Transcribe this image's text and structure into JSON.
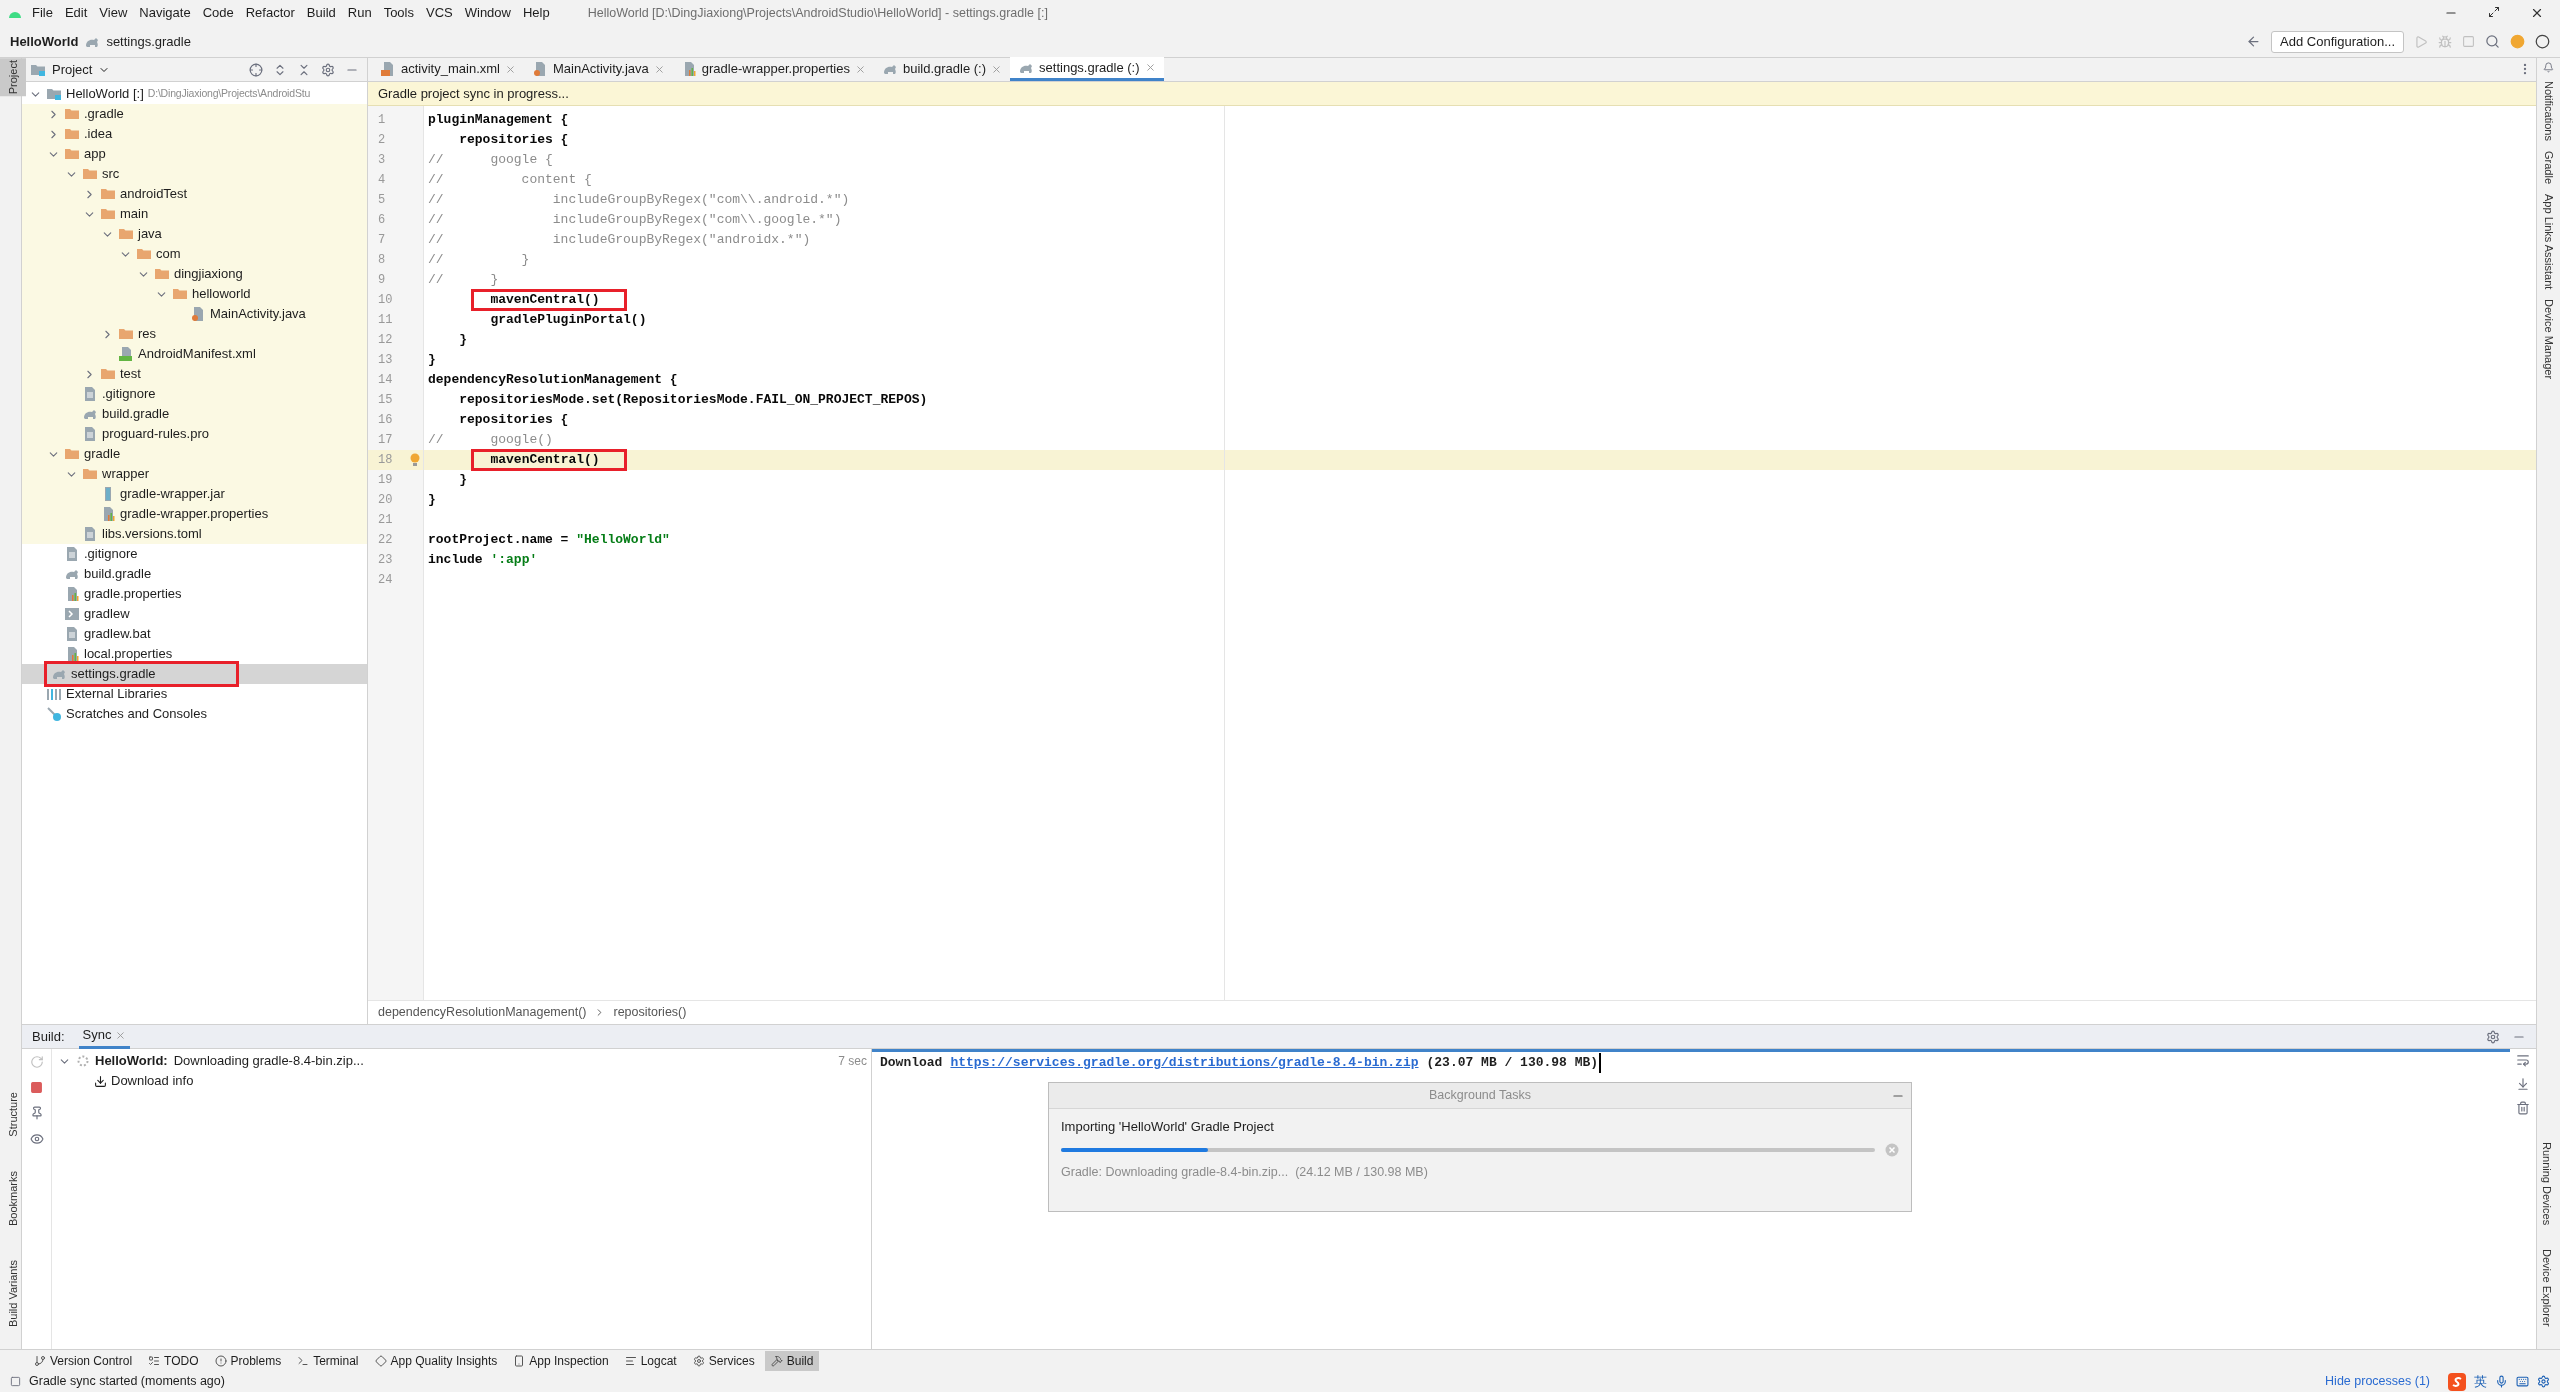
{
  "window": {
    "title": "HelloWorld [D:\\DingJiaxiong\\Projects\\AndroidStudio\\HelloWorld] - settings.gradle [:]",
    "menu": [
      "File",
      "Edit",
      "View",
      "Navigate",
      "Code",
      "Refactor",
      "Build",
      "Run",
      "Tools",
      "VCS",
      "Window",
      "Help"
    ]
  },
  "navbar": {
    "project": "HelloWorld",
    "file": "settings.gradle",
    "run_config": "Add Configuration..."
  },
  "left_stripe": {
    "top": [
      {
        "label": "Project",
        "selected": true
      }
    ],
    "bottom": [
      {
        "label": "Structure",
        "selected": false
      },
      {
        "label": "Bookmarks",
        "selected": false
      },
      {
        "label": "Build Variants",
        "selected": false
      }
    ]
  },
  "right_stripe": {
    "top": [
      "Notifications",
      "Gradle",
      "App Links Assistant",
      "Device Manager"
    ],
    "bottom": [
      "Running Devices",
      "Device Explorer"
    ]
  },
  "project_panel": {
    "title": "Project",
    "tree": [
      {
        "label": "HelloWorld [:]",
        "path": "D:\\DingJiaxiong\\Projects\\AndroidStu",
        "kind": "module",
        "expanded": true,
        "selected": false,
        "annotated": false,
        "children": [
          {
            "label": ".gradle",
            "kind": "folder",
            "expanded": false,
            "selected": false,
            "annotated": false,
            "tinted": true
          },
          {
            "label": ".idea",
            "kind": "folder",
            "expanded": false,
            "selected": false,
            "annotated": false,
            "tinted": true
          },
          {
            "label": "app",
            "kind": "folder",
            "expanded": true,
            "selected": false,
            "annotated": false,
            "tinted": true,
            "children": [
              {
                "label": "src",
                "kind": "folder",
                "expanded": true,
                "selected": false,
                "annotated": false,
                "children": [
                  {
                    "label": "androidTest",
                    "kind": "folder",
                    "expanded": false,
                    "selected": false,
                    "annotated": false
                  },
                  {
                    "label": "main",
                    "kind": "folder",
                    "expanded": true,
                    "selected": false,
                    "annotated": false,
                    "children": [
                      {
                        "label": "java",
                        "kind": "folder",
                        "expanded": true,
                        "selected": false,
                        "annotated": false,
                        "children": [
                          {
                            "label": "com",
                            "kind": "folder",
                            "expanded": true,
                            "selected": false,
                            "annotated": false,
                            "children": [
                              {
                                "label": "dingjiaxiong",
                                "kind": "folder",
                                "expanded": true,
                                "selected": false,
                                "annotated": false,
                                "children": [
                                  {
                                    "label": "helloworld",
                                    "kind": "folder",
                                    "expanded": true,
                                    "selected": false,
                                    "annotated": false,
                                    "children": [
                                      {
                                        "label": "MainActivity.java",
                                        "kind": "java",
                                        "selected": false,
                                        "annotated": false
                                      }
                                    ]
                                  }
                                ]
                              }
                            ]
                          }
                        ]
                      },
                      {
                        "label": "res",
                        "kind": "folder",
                        "expanded": false,
                        "selected": false,
                        "annotated": false
                      },
                      {
                        "label": "AndroidManifest.xml",
                        "kind": "manifest",
                        "selected": false,
                        "annotated": false
                      }
                    ]
                  },
                  {
                    "label": "test",
                    "kind": "folder",
                    "expanded": false,
                    "selected": false,
                    "annotated": false
                  }
                ]
              },
              {
                "label": ".gitignore",
                "kind": "ignore",
                "selected": false,
                "annotated": false
              },
              {
                "label": "build.gradle",
                "kind": "gradle",
                "selected": false,
                "annotated": false
              },
              {
                "label": "proguard-rules.pro",
                "kind": "text",
                "selected": false,
                "annotated": false
              }
            ]
          },
          {
            "label": "gradle",
            "kind": "folder",
            "expanded": true,
            "selected": false,
            "annotated": false,
            "tinted": true,
            "children": [
              {
                "label": "wrapper",
                "kind": "folder",
                "expanded": true,
                "selected": false,
                "annotated": false,
                "children": [
                  {
                    "label": "gradle-wrapper.jar",
                    "kind": "jar",
                    "selected": false,
                    "annotated": false
                  },
                  {
                    "label": "gradle-wrapper.properties",
                    "kind": "properties",
                    "selected": false,
                    "annotated": false
                  }
                ]
              },
              {
                "label": "libs.versions.toml",
                "kind": "toml",
                "selected": false,
                "annotated": false
              }
            ]
          },
          {
            "label": ".gitignore",
            "kind": "ignore",
            "selected": false,
            "annotated": false,
            "tinted": false
          },
          {
            "label": "build.gradle",
            "kind": "gradle",
            "selected": false,
            "annotated": false,
            "tinted": false
          },
          {
            "label": "gradle.properties",
            "kind": "properties",
            "selected": false,
            "annotated": false,
            "tinted": false
          },
          {
            "label": "gradlew",
            "kind": "script",
            "selected": false,
            "annotated": false,
            "tinted": false
          },
          {
            "label": "gradlew.bat",
            "kind": "text",
            "selected": false,
            "annotated": false,
            "tinted": false
          },
          {
            "label": "local.properties",
            "kind": "properties",
            "selected": false,
            "annotated": false,
            "tinted": false
          },
          {
            "label": "settings.gradle",
            "kind": "gradle",
            "selected": true,
            "annotated": true,
            "tinted": false
          }
        ]
      },
      {
        "label": "External Libraries",
        "kind": "libraries",
        "selected": false,
        "annotated": false
      },
      {
        "label": "Scratches and Consoles",
        "kind": "scratches",
        "selected": false,
        "annotated": false
      }
    ]
  },
  "editor": {
    "tabs": [
      {
        "label": "activity_main.xml",
        "kind": "xml",
        "selected": false
      },
      {
        "label": "MainActivity.java",
        "kind": "java",
        "selected": false
      },
      {
        "label": "gradle-wrapper.properties",
        "kind": "properties",
        "selected": false
      },
      {
        "label": "build.gradle (:)",
        "kind": "gradle",
        "selected": false
      },
      {
        "label": "settings.gradle (:)",
        "kind": "gradle",
        "selected": true
      }
    ],
    "banner": "Gradle project sync in progress...",
    "lines": [
      {
        "number": "1",
        "current": false,
        "segments": [
          {
            "text": "pluginManagement {",
            "kind": "code",
            "boxed": false
          }
        ]
      },
      {
        "number": "2",
        "current": false,
        "segments": [
          {
            "text": "    repositories {",
            "kind": "code",
            "boxed": false
          }
        ]
      },
      {
        "number": "3",
        "current": false,
        "segments": [
          {
            "text": "//      google {",
            "kind": "comment",
            "boxed": false
          }
        ]
      },
      {
        "number": "4",
        "current": false,
        "segments": [
          {
            "text": "//          content {",
            "kind": "comment",
            "boxed": false
          }
        ]
      },
      {
        "number": "5",
        "current": false,
        "segments": [
          {
            "text": "//              includeGroupByRegex(\"com\\\\.android.*\")",
            "kind": "comment",
            "boxed": false
          }
        ]
      },
      {
        "number": "6",
        "current": false,
        "segments": [
          {
            "text": "//              includeGroupByRegex(\"com\\\\.google.*\")",
            "kind": "comment",
            "boxed": false
          }
        ]
      },
      {
        "number": "7",
        "current": false,
        "segments": [
          {
            "text": "//              includeGroupByRegex(\"androidx.*\")",
            "kind": "comment",
            "boxed": false
          }
        ]
      },
      {
        "number": "8",
        "current": false,
        "segments": [
          {
            "text": "//          }",
            "kind": "comment",
            "boxed": false
          }
        ]
      },
      {
        "number": "9",
        "current": false,
        "segments": [
          {
            "text": "//      }",
            "kind": "comment",
            "boxed": false
          }
        ]
      },
      {
        "number": "10",
        "current": false,
        "segments": [
          {
            "text": "        mavenCentral()",
            "kind": "code",
            "boxed": true
          }
        ]
      },
      {
        "number": "11",
        "current": false,
        "segments": [
          {
            "text": "        gradlePluginPortal()",
            "kind": "code",
            "boxed": false
          }
        ]
      },
      {
        "number": "12",
        "current": false,
        "segments": [
          {
            "text": "    }",
            "kind": "code",
            "boxed": false
          }
        ]
      },
      {
        "number": "13",
        "current": false,
        "segments": [
          {
            "text": "}",
            "kind": "code",
            "boxed": false
          }
        ]
      },
      {
        "number": "14",
        "current": false,
        "segments": [
          {
            "text": "dependencyResolutionManagement {",
            "kind": "code",
            "boxed": false
          }
        ]
      },
      {
        "number": "15",
        "current": false,
        "segments": [
          {
            "text": "    repositoriesMode.set(RepositoriesMode.FAIL_ON_PROJECT_REPOS)",
            "kind": "code",
            "boxed": false
          }
        ]
      },
      {
        "number": "16",
        "current": false,
        "segments": [
          {
            "text": "    repositories {",
            "kind": "code",
            "boxed": false
          }
        ]
      },
      {
        "number": "17",
        "current": false,
        "segments": [
          {
            "text": "//      google()",
            "kind": "comment",
            "boxed": false
          }
        ]
      },
      {
        "number": "18",
        "current": true,
        "segments": [
          {
            "text": "        mavenCentral()",
            "kind": "code",
            "boxed": true
          }
        ]
      },
      {
        "number": "19",
        "current": false,
        "segments": [
          {
            "text": "    }",
            "kind": "code",
            "boxed": false
          }
        ]
      },
      {
        "number": "20",
        "current": false,
        "segments": [
          {
            "text": "}",
            "kind": "code",
            "boxed": false
          }
        ]
      },
      {
        "number": "21",
        "current": false
      },
      {
        "number": "22",
        "current": false,
        "segments": [
          {
            "text": "rootProject.name = ",
            "kind": "code",
            "boxed": false
          },
          {
            "text": "\"HelloWorld\"",
            "kind": "string",
            "boxed": false
          }
        ]
      },
      {
        "number": "23",
        "current": false,
        "segments": [
          {
            "text": "include ",
            "kind": "code",
            "boxed": false
          },
          {
            "text": "':app'",
            "kind": "string",
            "boxed": false
          }
        ]
      },
      {
        "number": "24",
        "current": false
      }
    ],
    "breadcrumbs": [
      "dependencyResolutionManagement()",
      "repositories()"
    ]
  },
  "build_panel": {
    "label": "Build:",
    "tabs": [
      {
        "label": "Sync",
        "selected": true
      }
    ],
    "task": {
      "name": "HelloWorld:",
      "status": "Downloading gradle-8.4-bin.zip...",
      "time": "7 sec",
      "children": [
        "Download info"
      ]
    },
    "console": {
      "prefix": "Download",
      "link": "https://services.gradle.org/distributions/gradle-8.4-bin.zip",
      "suffix": "(23.07 MB / 130.98 MB)"
    },
    "background_tasks": {
      "title": "Background Tasks",
      "task": "Importing 'HelloWorld' Gradle Project",
      "level": 0.18,
      "detail": "Gradle: Downloading gradle-8.4-bin.zip...  (24.12 MB / 130.98 MB)"
    }
  },
  "tool_strip": [
    {
      "label": "Version Control",
      "kind": "vcs",
      "selected": false
    },
    {
      "label": "TODO",
      "kind": "todo",
      "selected": false
    },
    {
      "label": "Problems",
      "kind": "problems",
      "selected": false
    },
    {
      "label": "Terminal",
      "kind": "terminal",
      "selected": false
    },
    {
      "label": "App Quality Insights",
      "kind": "insights",
      "selected": false
    },
    {
      "label": "App Inspection",
      "kind": "inspection",
      "selected": false
    },
    {
      "label": "Logcat",
      "kind": "logcat",
      "selected": false
    },
    {
      "label": "Services",
      "kind": "services",
      "selected": false
    },
    {
      "label": "Build",
      "kind": "build",
      "selected": true
    }
  ],
  "status_bar": {
    "message": "Gradle sync started (moments ago)",
    "processes": "Hide processes (1)",
    "ime": "英"
  }
}
